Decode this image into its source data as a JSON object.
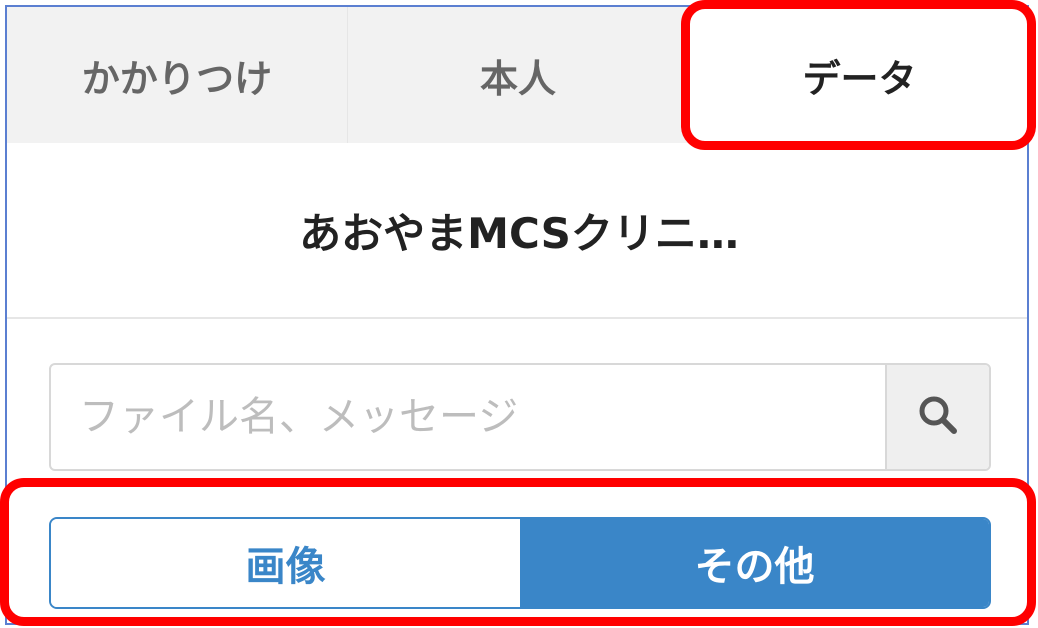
{
  "tabs": [
    {
      "label": "かかりつけ",
      "active": false
    },
    {
      "label": "本人",
      "active": false
    },
    {
      "label": "データ",
      "active": true
    }
  ],
  "clinic": {
    "name": "あおやまMCSクリニ…"
  },
  "search": {
    "placeholder": "ファイル名、メッセージ",
    "value": "",
    "icon": "search-icon"
  },
  "filter": {
    "options": [
      {
        "label": "画像",
        "selected": false
      },
      {
        "label": "その他",
        "selected": true
      }
    ]
  },
  "colors": {
    "accent": "#3a86c8",
    "highlight": "#ff0000",
    "frame": "#5b7fd1",
    "tab_inactive_bg": "#f2f2f2"
  }
}
